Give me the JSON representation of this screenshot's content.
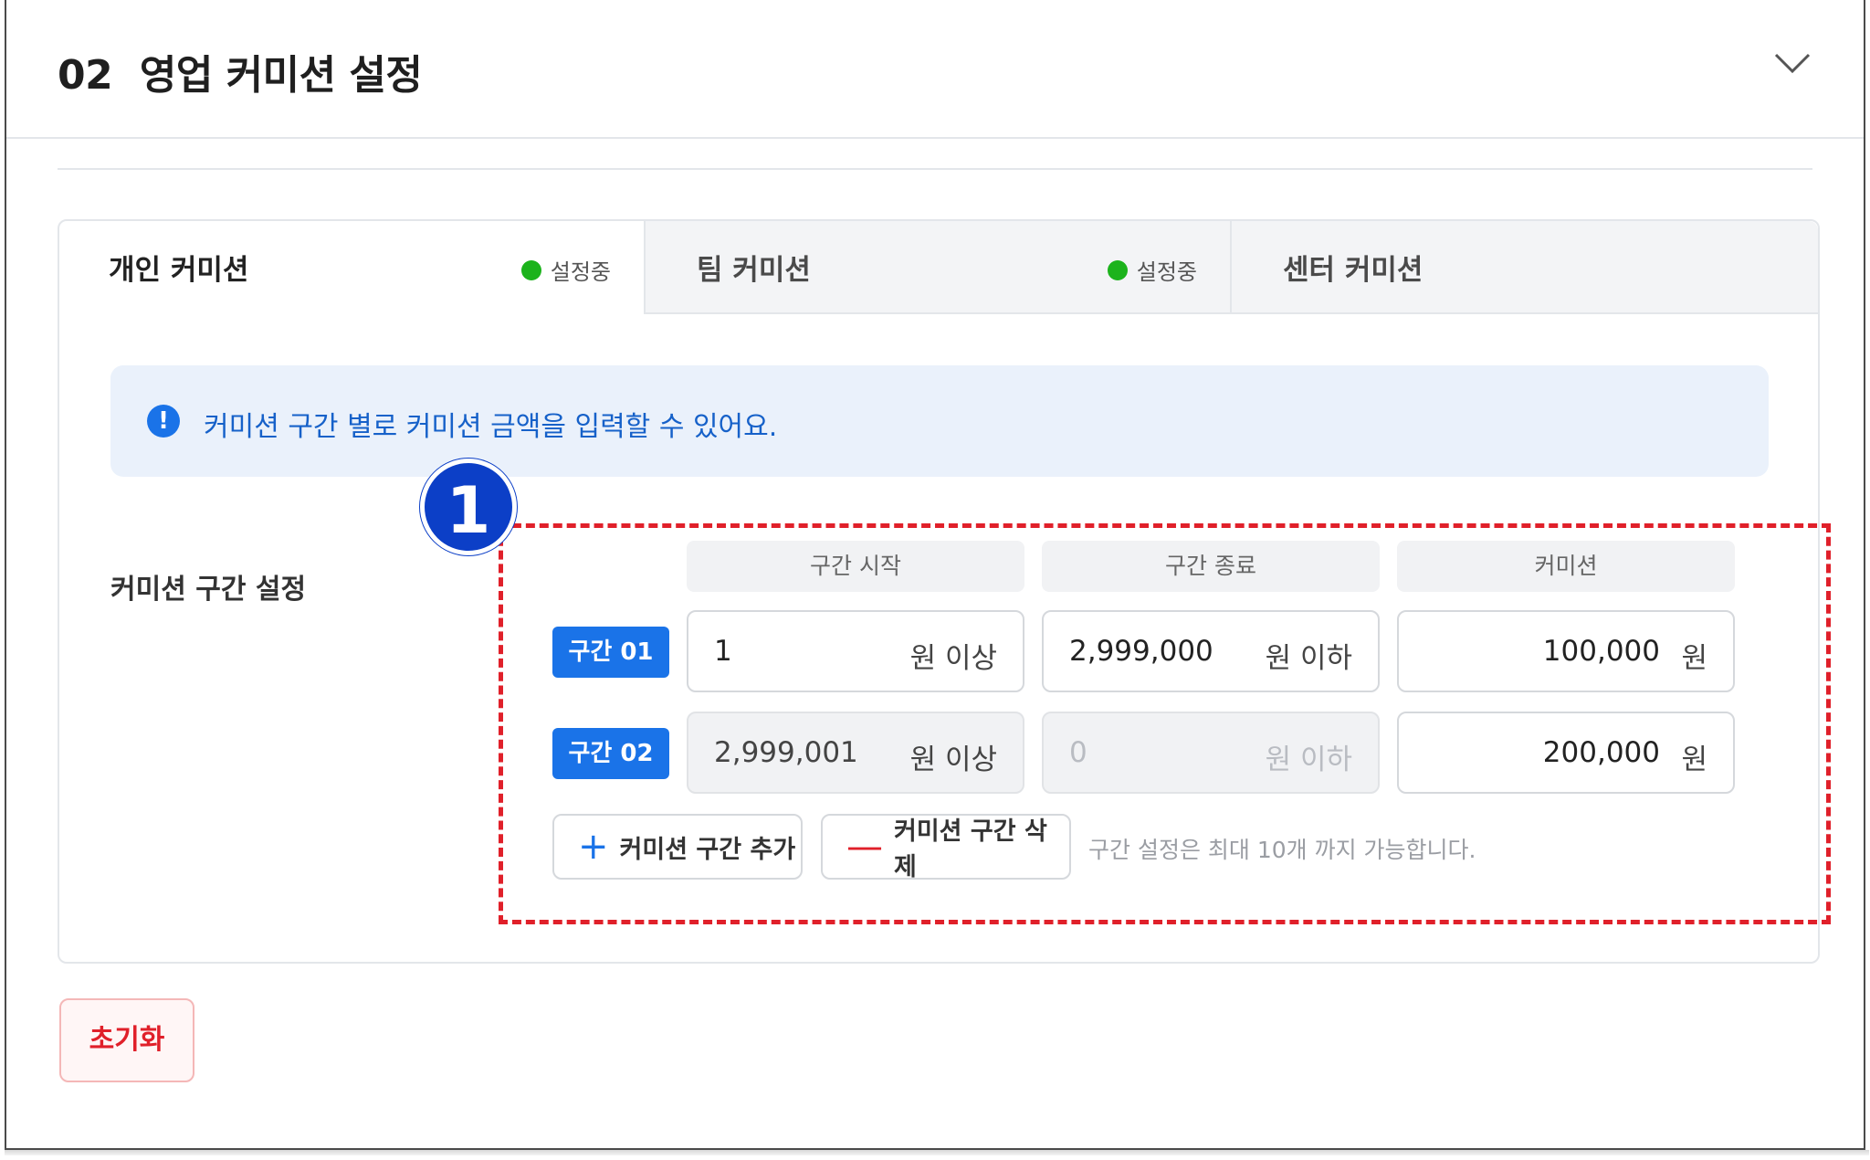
{
  "section": {
    "number": "02",
    "title": "영업 커미션 설정"
  },
  "tabs": [
    {
      "label": "개인 커미션",
      "status": "설정중"
    },
    {
      "label": "팀 커미션",
      "status": "설정중"
    },
    {
      "label": "센터 커미션"
    }
  ],
  "colors": {
    "accent": "#1a73e8",
    "status_dot": "#1cb31c",
    "danger": "#e0202a",
    "annotation_badge": "#0c3fc7"
  },
  "info": {
    "icon": "exclamation-icon",
    "text": "커미션 구간 별로 커미션 금액을 입력할 수 있어요."
  },
  "range_settings": {
    "label": "커미션 구간 설정",
    "annotation_number": "1",
    "columns": [
      "구간 시작",
      "구간 종료",
      "커미션"
    ],
    "rows": [
      {
        "tag": "구간 01",
        "start": "1",
        "start_unit": "원 이상",
        "end": "2,999,000",
        "end_unit": "원 이하",
        "commission": "100,000",
        "commission_unit": "원"
      },
      {
        "tag": "구간 02",
        "start": "2,999,001",
        "start_unit": "원 이상",
        "end": "0",
        "end_unit": "원 이하",
        "commission": "200,000",
        "commission_unit": "원"
      }
    ],
    "add_button": "커미션 구간 추가",
    "remove_button": "커미션 구간 삭제",
    "hint": "구간 설정은 최대 10개 까지 가능합니다."
  },
  "reset_button": "초기화"
}
